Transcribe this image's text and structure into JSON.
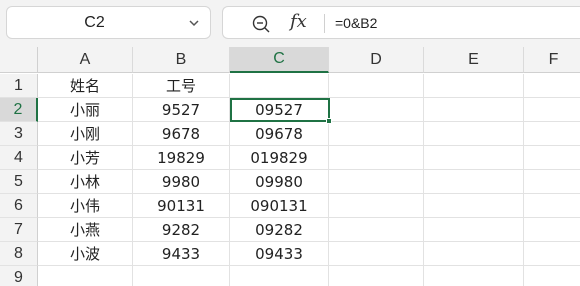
{
  "name_box": {
    "value": "C2"
  },
  "formula_bar": {
    "formula": "=0&B2",
    "fx_label": "fx"
  },
  "columns": [
    "A",
    "B",
    "C",
    "D",
    "E",
    "F"
  ],
  "rows": [
    "1",
    "2",
    "3",
    "4",
    "5",
    "6",
    "7",
    "8",
    "9"
  ],
  "selected": {
    "column": "C",
    "row": "2"
  },
  "cells": [
    [
      "姓名",
      "工号",
      ""
    ],
    [
      "小丽",
      "9527",
      "09527"
    ],
    [
      "小刚",
      "9678",
      "09678"
    ],
    [
      "小芳",
      "19829",
      "019829"
    ],
    [
      "小林",
      "9980",
      "09980"
    ],
    [
      "小伟",
      "90131",
      "090131"
    ],
    [
      "小燕",
      "9282",
      "09282"
    ],
    [
      "小波",
      "9433",
      "09433"
    ],
    [
      "",
      "",
      ""
    ]
  ],
  "colors": {
    "accent": "#1f7244"
  }
}
